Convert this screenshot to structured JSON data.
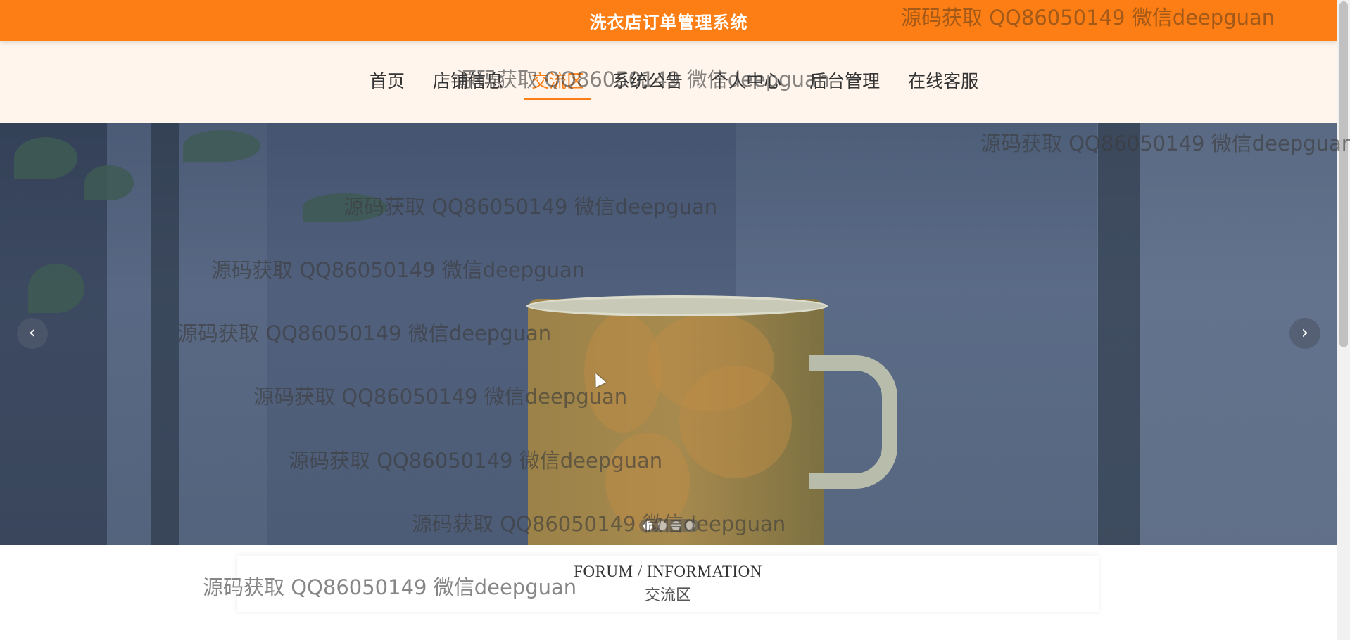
{
  "header": {
    "title": "洗衣店订单管理系统",
    "background_color": "#fd7e14"
  },
  "nav": {
    "items": [
      {
        "label": "首页",
        "active": false
      },
      {
        "label": "店铺信息",
        "active": false
      },
      {
        "label": "交流区",
        "active": true
      },
      {
        "label": "系统公告",
        "active": false
      },
      {
        "label": "个人中心",
        "active": false
      },
      {
        "label": "后台管理",
        "active": false
      },
      {
        "label": "在线客服",
        "active": false
      }
    ],
    "accent_color": "#fd7e14"
  },
  "carousel": {
    "prev_icon": "chevron-left-icon",
    "next_icon": "chevron-right-icon",
    "prev_glyph": "‹",
    "next_glyph": "›",
    "slide_count": 4,
    "active_slide": 1
  },
  "section": {
    "title_en": "FORUM / INFORMATION",
    "title_zh": "交流区"
  },
  "watermark": {
    "text": "源码获取 QQ86050149 微信deepguan"
  }
}
